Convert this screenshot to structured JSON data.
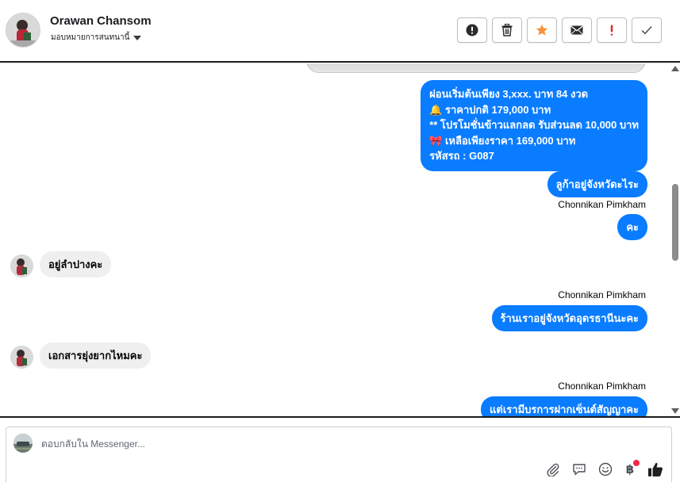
{
  "header": {
    "contact_name": "Orawan Chansom",
    "assign_label": "มอบหมายการสนทนานี้",
    "actions": [
      {
        "id": "spam",
        "icon": "alert-circle-icon"
      },
      {
        "id": "delete",
        "icon": "trash-icon"
      },
      {
        "id": "star",
        "icon": "star-icon",
        "color": "#f7923b"
      },
      {
        "id": "mark-unread",
        "icon": "envelope-icon"
      },
      {
        "id": "follow-up",
        "icon": "exclamation-icon",
        "color": "#e02424"
      },
      {
        "id": "done",
        "icon": "check-icon"
      }
    ]
  },
  "messages": {
    "promo_lines": [
      "ผ่อนเริ่มต้นเพียง 3,xxx. บาท 84 งวด",
      "🔔 ราคาปกติ 179,000 บาท",
      "** โปรโมชั่นข้าวแลกลด รับส่วนลด 10,000 บาท",
      "🎀  เหลือเพียงราคา 169,000 บาท",
      " รหัสรถ : G087"
    ],
    "ask_province": "ลูก้าอยู่จังหวัดะไระ",
    "sender_1": "Chonnikan Pimkham",
    "ka": "คะ",
    "reply_lampang": "อยู่ลำปางคะ",
    "sender_2": "Chonnikan Pimkham",
    "shop_location": "ร้านเราอยู่จังหวัดอุดรธานีนะคะ",
    "reply_docs": "เอกสารยุ่งยากไหมคะ",
    "sender_3": "Chonnikan Pimkham",
    "consign_contract": "แต่เรามีบรการฝากเซ็นต์สัญญาคะ"
  },
  "composer": {
    "placeholder": "ตอบกลับใน Messenger...",
    "baht_symbol": "฿",
    "tools": [
      "paperclip-icon",
      "speech-bubble-icon",
      "smiley-icon",
      "baht-icon",
      "thumbs-up-icon"
    ]
  },
  "colors": {
    "outgoing_bubble": "#0a7cff",
    "incoming_bubble": "#efefef",
    "star": "#f7923b",
    "follow_up": "#e02424"
  }
}
